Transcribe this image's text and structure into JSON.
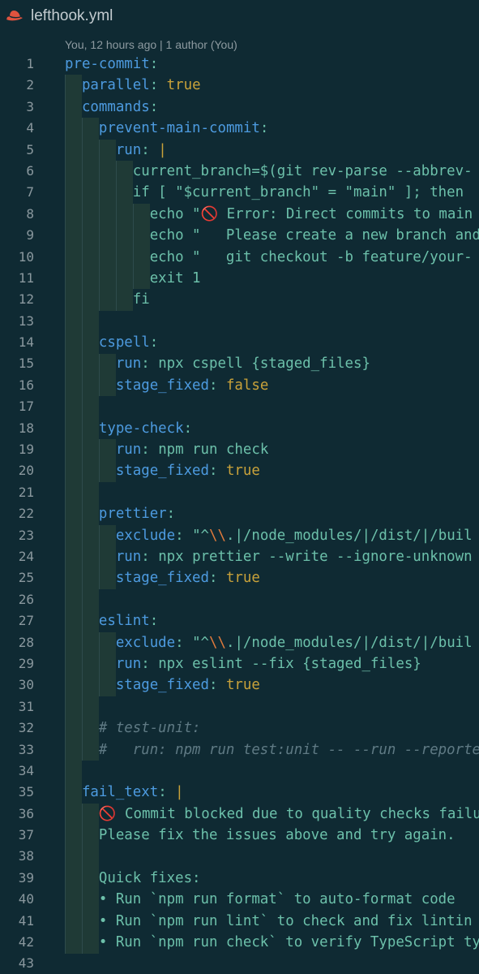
{
  "tab": {
    "title": "lefthook.yml",
    "icon": "lefthook-icon",
    "icon_color": "#e0533f"
  },
  "codelens": {
    "text": "You, 12 hours ago | 1 author (You)"
  },
  "colors": {
    "background": "#0f2a33",
    "key": "#4d9be0",
    "plain": "#6cc0aa",
    "value": "#c9a23a",
    "escape": "#e07a3c",
    "comment": "#5f7a84",
    "line_number": "#8a989e",
    "guide_fill": "#1f3a36",
    "guide_line": "#2e4b4c"
  },
  "editor": {
    "lines": [
      {
        "n": "1",
        "tokens": [
          {
            "t": "pre-commit",
            "c": "key"
          },
          {
            "t": ":",
            "c": "plain"
          }
        ]
      },
      {
        "n": "2",
        "tokens": [
          {
            "t": "  ",
            "c": "plain"
          },
          {
            "t": "parallel",
            "c": "key"
          },
          {
            "t": ": ",
            "c": "plain"
          },
          {
            "t": "true",
            "c": "value"
          }
        ]
      },
      {
        "n": "3",
        "tokens": [
          {
            "t": "  ",
            "c": "plain"
          },
          {
            "t": "commands",
            "c": "key"
          },
          {
            "t": ":",
            "c": "plain"
          }
        ]
      },
      {
        "n": "4",
        "tokens": [
          {
            "t": "    ",
            "c": "plain"
          },
          {
            "t": "prevent-main-commit",
            "c": "key"
          },
          {
            "t": ":",
            "c": "plain"
          }
        ]
      },
      {
        "n": "5",
        "tokens": [
          {
            "t": "      ",
            "c": "plain"
          },
          {
            "t": "run",
            "c": "key"
          },
          {
            "t": ": ",
            "c": "plain"
          },
          {
            "t": "|",
            "c": "value"
          }
        ]
      },
      {
        "n": "6",
        "tokens": [
          {
            "t": "        current_branch=$(git rev-parse --abbrev-",
            "c": "plain"
          }
        ]
      },
      {
        "n": "7",
        "tokens": [
          {
            "t": "        if [ \"$current_branch\" = \"main\" ]; then",
            "c": "plain"
          }
        ]
      },
      {
        "n": "8",
        "tokens": [
          {
            "t": "          echo \"🚫 Error: Direct commits to main",
            "c": "plain"
          }
        ]
      },
      {
        "n": "9",
        "tokens": [
          {
            "t": "          echo \"   Please create a new branch and",
            "c": "plain"
          }
        ]
      },
      {
        "n": "10",
        "tokens": [
          {
            "t": "          echo \"   git checkout -b feature/your-",
            "c": "plain"
          }
        ]
      },
      {
        "n": "11",
        "tokens": [
          {
            "t": "          exit 1",
            "c": "plain"
          }
        ]
      },
      {
        "n": "12",
        "tokens": [
          {
            "t": "        fi",
            "c": "plain"
          }
        ]
      },
      {
        "n": "13",
        "tokens": []
      },
      {
        "n": "14",
        "tokens": [
          {
            "t": "    ",
            "c": "plain"
          },
          {
            "t": "cspell",
            "c": "key"
          },
          {
            "t": ":",
            "c": "plain"
          }
        ]
      },
      {
        "n": "15",
        "tokens": [
          {
            "t": "      ",
            "c": "plain"
          },
          {
            "t": "run",
            "c": "key"
          },
          {
            "t": ": npx cspell {staged_files}",
            "c": "plain"
          }
        ]
      },
      {
        "n": "16",
        "tokens": [
          {
            "t": "      ",
            "c": "plain"
          },
          {
            "t": "stage_fixed",
            "c": "key"
          },
          {
            "t": ": ",
            "c": "plain"
          },
          {
            "t": "false",
            "c": "value"
          }
        ]
      },
      {
        "n": "17",
        "tokens": []
      },
      {
        "n": "18",
        "tokens": [
          {
            "t": "    ",
            "c": "plain"
          },
          {
            "t": "type-check",
            "c": "key"
          },
          {
            "t": ":",
            "c": "plain"
          }
        ]
      },
      {
        "n": "19",
        "tokens": [
          {
            "t": "      ",
            "c": "plain"
          },
          {
            "t": "run",
            "c": "key"
          },
          {
            "t": ": npm run check",
            "c": "plain"
          }
        ]
      },
      {
        "n": "20",
        "tokens": [
          {
            "t": "      ",
            "c": "plain"
          },
          {
            "t": "stage_fixed",
            "c": "key"
          },
          {
            "t": ": ",
            "c": "plain"
          },
          {
            "t": "true",
            "c": "value"
          }
        ]
      },
      {
        "n": "21",
        "tokens": []
      },
      {
        "n": "22",
        "tokens": [
          {
            "t": "    ",
            "c": "plain"
          },
          {
            "t": "prettier",
            "c": "key"
          },
          {
            "t": ":",
            "c": "plain"
          }
        ]
      },
      {
        "n": "23",
        "tokens": [
          {
            "t": "      ",
            "c": "plain"
          },
          {
            "t": "exclude",
            "c": "key"
          },
          {
            "t": ": \"^",
            "c": "plain"
          },
          {
            "t": "\\\\",
            "c": "escape"
          },
          {
            "t": ".|/node_modules/|/dist/|/buil",
            "c": "plain"
          }
        ]
      },
      {
        "n": "24",
        "tokens": [
          {
            "t": "      ",
            "c": "plain"
          },
          {
            "t": "run",
            "c": "key"
          },
          {
            "t": ": npx prettier --write --ignore-unknown",
            "c": "plain"
          }
        ]
      },
      {
        "n": "25",
        "tokens": [
          {
            "t": "      ",
            "c": "plain"
          },
          {
            "t": "stage_fixed",
            "c": "key"
          },
          {
            "t": ": ",
            "c": "plain"
          },
          {
            "t": "true",
            "c": "value"
          }
        ]
      },
      {
        "n": "26",
        "tokens": []
      },
      {
        "n": "27",
        "tokens": [
          {
            "t": "    ",
            "c": "plain"
          },
          {
            "t": "eslint",
            "c": "key"
          },
          {
            "t": ":",
            "c": "plain"
          }
        ]
      },
      {
        "n": "28",
        "tokens": [
          {
            "t": "      ",
            "c": "plain"
          },
          {
            "t": "exclude",
            "c": "key"
          },
          {
            "t": ": \"^",
            "c": "plain"
          },
          {
            "t": "\\\\",
            "c": "escape"
          },
          {
            "t": ".|/node_modules/|/dist/|/buil",
            "c": "plain"
          }
        ]
      },
      {
        "n": "29",
        "tokens": [
          {
            "t": "      ",
            "c": "plain"
          },
          {
            "t": "run",
            "c": "key"
          },
          {
            "t": ": npx eslint --fix {staged_files}",
            "c": "plain"
          }
        ]
      },
      {
        "n": "30",
        "tokens": [
          {
            "t": "      ",
            "c": "plain"
          },
          {
            "t": "stage_fixed",
            "c": "key"
          },
          {
            "t": ": ",
            "c": "plain"
          },
          {
            "t": "true",
            "c": "value"
          }
        ]
      },
      {
        "n": "31",
        "tokens": []
      },
      {
        "n": "32",
        "tokens": [
          {
            "t": "    # test-unit:",
            "c": "comment"
          }
        ]
      },
      {
        "n": "33",
        "tokens": [
          {
            "t": "    #   run: npm run test:unit -- --run --reporte",
            "c": "comment"
          }
        ]
      },
      {
        "n": "34",
        "tokens": []
      },
      {
        "n": "35",
        "tokens": [
          {
            "t": "  ",
            "c": "plain"
          },
          {
            "t": "fail_text",
            "c": "key"
          },
          {
            "t": ": ",
            "c": "plain"
          },
          {
            "t": "|",
            "c": "value"
          }
        ]
      },
      {
        "n": "36",
        "tokens": [
          {
            "t": "    🚫 Commit blocked due to quality checks failu",
            "c": "plain"
          }
        ]
      },
      {
        "n": "37",
        "tokens": [
          {
            "t": "    Please fix the issues above and try again.",
            "c": "plain"
          }
        ]
      },
      {
        "n": "38",
        "tokens": []
      },
      {
        "n": "39",
        "tokens": [
          {
            "t": "    Quick fixes:",
            "c": "plain"
          }
        ]
      },
      {
        "n": "40",
        "tokens": [
          {
            "t": "    • Run `npm run format` to auto-format code",
            "c": "plain"
          }
        ]
      },
      {
        "n": "41",
        "tokens": [
          {
            "t": "    • Run `npm run lint` to check and fix lintin",
            "c": "plain"
          }
        ]
      },
      {
        "n": "42",
        "tokens": [
          {
            "t": "    • Run `npm run check` to verify TypeScript ty",
            "c": "plain"
          }
        ]
      },
      {
        "n": "43",
        "tokens": []
      }
    ]
  }
}
